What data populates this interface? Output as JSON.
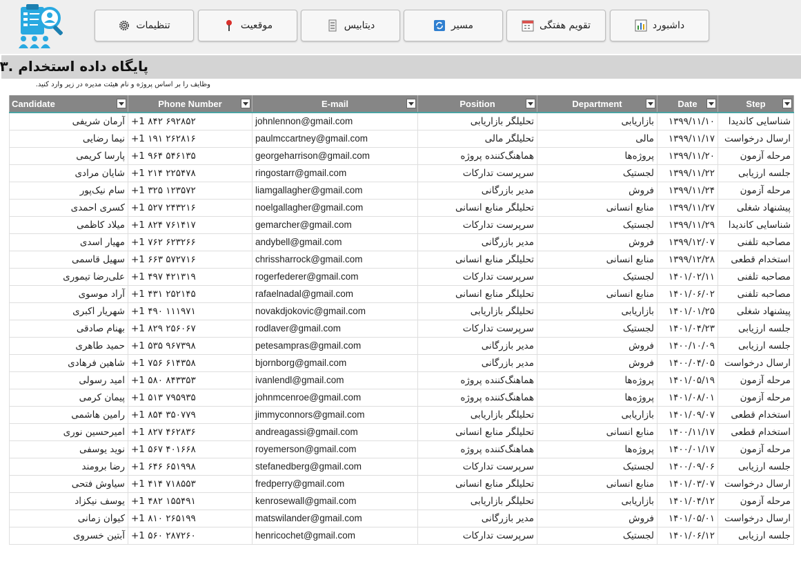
{
  "nav": {
    "buttons": [
      {
        "label": "داشبورد",
        "icon": "bar-chart-icon"
      },
      {
        "label": "تقویم هفتگی",
        "icon": "calendar-icon"
      },
      {
        "label": "مسیر",
        "icon": "refresh-icon"
      },
      {
        "label": "دیتابیس",
        "icon": "database-icon"
      },
      {
        "label": "موقعیت",
        "icon": "pin-icon"
      },
      {
        "label": "تنظیمات",
        "icon": "gear-icon"
      }
    ]
  },
  "page": {
    "title": "پایگاه داده استخدام .۳",
    "subtitle": "وظایف را بر اساس پروژه و نام هیئت مدیره در زیر وارد کنید."
  },
  "colors": {
    "header_bg": "#868686",
    "accent_line": "#4aa3a3",
    "email_link": "#1f5fbf",
    "title_bar": "#d4d4d4"
  },
  "table": {
    "headers": {
      "candidate": "Candidate",
      "phone": "Phone Number",
      "email": "E-mail",
      "position": "Position",
      "department": "Department",
      "date": "Date",
      "step": "Step"
    },
    "rows": [
      {
        "candidate": "آرمان شریفی",
        "phone": "+1 ۸۴۲ ۶۹۲۸۵۲",
        "email": "johnlennon@gmail.com",
        "position": "تحلیلگر بازاریابی",
        "department": "بازاریابی",
        "date": "۱۳۹۹/۱۱/۱۰",
        "step": "شناسایی کاندیدا"
      },
      {
        "candidate": "نیما رضایی",
        "phone": "+1 ۱۹۱ ۲۶۲۸۱۶",
        "email": "paulmccartney@gmail.com",
        "position": "تحلیلگر مالی",
        "department": "مالی",
        "date": "۱۳۹۹/۱۱/۱۷",
        "step": "ارسال درخواست"
      },
      {
        "candidate": "پارسا کریمی",
        "phone": "+1 ۹۶۴ ۵۴۶۱۳۵",
        "email": "georgeharrison@gmail.com",
        "position": "هماهنگ‌کننده پروژه",
        "department": "پروژه‌ها",
        "date": "۱۳۹۹/۱۱/۲۰",
        "step": "مرحله آزمون"
      },
      {
        "candidate": "شایان مرادی",
        "phone": "+1 ۲۱۴ ۲۲۵۴۷۸",
        "email": "ringostarr@gmail.com",
        "position": "سرپرست تدارکات",
        "department": "لجستیک",
        "date": "۱۳۹۹/۱۱/۲۲",
        "step": "جلسه ارزیابی"
      },
      {
        "candidate": "سام نیک‌پور",
        "phone": "+1 ۳۲۵ ۱۲۳۵۷۲",
        "email": "liamgallagher@gmail.com",
        "position": "مدیر بازرگانی",
        "department": "فروش",
        "date": "۱۳۹۹/۱۱/۲۴",
        "step": "مرحله آزمون"
      },
      {
        "candidate": "کسری احمدی",
        "phone": "+1 ۵۲۷ ۲۴۳۲۱۶",
        "email": "noelgallagher@gmail.com",
        "position": "تحلیلگر منابع انسانی",
        "department": "منابع انسانی",
        "date": "۱۳۹۹/۱۱/۲۷",
        "step": "پیشنهاد شغلی"
      },
      {
        "candidate": "میلاد کاظمی",
        "phone": "+1 ۸۲۴ ۷۶۱۴۱۷",
        "email": "gemarcher@gmail.com",
        "position": "سرپرست تدارکات",
        "department": "لجستیک",
        "date": "۱۳۹۹/۱۱/۲۹",
        "step": "شناسایی کاندیدا"
      },
      {
        "candidate": "مهیار اسدی",
        "phone": "+1 ۷۶۲ ۶۲۳۲۶۶",
        "email": "andybell@gmail.com",
        "position": "مدیر بازرگانی",
        "department": "فروش",
        "date": "۱۳۹۹/۱۲/۰۷",
        "step": "مصاحبه تلفنی"
      },
      {
        "candidate": "سهیل قاسمی",
        "phone": "+1 ۶۶۳ ۵۷۲۷۱۶",
        "email": "chrissharrock@gmail.com",
        "position": "تحلیلگر منابع انسانی",
        "department": "منابع انسانی",
        "date": "۱۳۹۹/۱۲/۲۸",
        "step": "استخدام قطعی"
      },
      {
        "candidate": "علی‌رضا تیموری",
        "phone": "+1 ۴۹۷ ۴۲۱۳۱۹",
        "email": "rogerfederer@gmail.com",
        "position": "سرپرست تدارکات",
        "department": "لجستیک",
        "date": "۱۴۰۱/۰۲/۱۱",
        "step": "مصاحبه تلفنی"
      },
      {
        "candidate": "آراد موسوی",
        "phone": "+1 ۴۳۱ ۲۵۲۱۴۵",
        "email": "rafaelnadal@gmail.com",
        "position": "تحلیلگر منابع انسانی",
        "department": "منابع انسانی",
        "date": "۱۴۰۱/۰۶/۰۲",
        "step": "مصاحبه تلفنی"
      },
      {
        "candidate": "شهریار اکبری",
        "phone": "+1 ۴۹۰ ۱۱۱۹۷۱",
        "email": "novakdjokovic@gmail.com",
        "position": "تحلیلگر بازاریابی",
        "department": "بازاریابی",
        "date": "۱۴۰۱/۰۱/۲۵",
        "step": "پیشنهاد شغلی"
      },
      {
        "candidate": "بهنام صادقی",
        "phone": "+1 ۸۲۹ ۲۵۶۰۶۷",
        "email": "rodlaver@gmail.com",
        "position": "سرپرست تدارکات",
        "department": "لجستیک",
        "date": "۱۴۰۱/۰۴/۲۳",
        "step": "جلسه ارزیابی"
      },
      {
        "candidate": "حمید طاهری",
        "phone": "+1 ۵۳۵ ۹۶۷۳۹۸",
        "email": "petesampras@gmail.com",
        "position": "مدیر بازرگانی",
        "department": "فروش",
        "date": "۱۴۰۰/۱۰/۰۹",
        "step": "جلسه ارزیابی"
      },
      {
        "candidate": "شاهین فرهادی",
        "phone": "+1 ۷۵۶ ۶۱۴۳۵۸",
        "email": "bjornborg@gmail.com",
        "position": "مدیر بازرگانی",
        "department": "فروش",
        "date": "۱۴۰۰/۰۴/۰۵",
        "step": "ارسال درخواست"
      },
      {
        "candidate": "امید رسولی",
        "phone": "+1 ۵۸۰ ۸۴۳۳۵۳",
        "email": "ivanlendl@gmail.com",
        "position": "هماهنگ‌کننده پروژه",
        "department": "پروژه‌ها",
        "date": "۱۴۰۱/۰۵/۱۹",
        "step": "مرحله آزمون"
      },
      {
        "candidate": "پیمان کرمی",
        "phone": "+1 ۵۱۳ ۷۹۵۹۳۵",
        "email": "johnmcenroe@gmail.com",
        "position": "هماهنگ‌کننده پروژه",
        "department": "پروژه‌ها",
        "date": "۱۴۰۱/۰۸/۰۱",
        "step": "مرحله آزمون"
      },
      {
        "candidate": "رامین هاشمی",
        "phone": "+1 ۸۵۴ ۳۵۰۷۷۹",
        "email": "jimmyconnors@gmail.com",
        "position": "تحلیلگر بازاریابی",
        "department": "بازاریابی",
        "date": "۱۴۰۱/۰۹/۰۷",
        "step": "استخدام قطعی"
      },
      {
        "candidate": "امیرحسین نوری",
        "phone": "+1 ۸۲۷ ۴۶۲۸۳۶",
        "email": "andreagassi@gmail.com",
        "position": "تحلیلگر منابع انسانی",
        "department": "منابع انسانی",
        "date": "۱۴۰۰/۱۱/۱۷",
        "step": "استخدام قطعی"
      },
      {
        "candidate": "نوید یوسفی",
        "phone": "+1 ۵۶۷ ۴۰۱۶۶۸",
        "email": "royemerson@gmail.com",
        "position": "هماهنگ‌کننده پروژه",
        "department": "پروژه‌ها",
        "date": "۱۴۰۰/۰۱/۱۷",
        "step": "مرحله آزمون"
      },
      {
        "candidate": "رضا برومند",
        "phone": "+1 ۶۴۶ ۶۵۱۹۹۸",
        "email": "stefanedberg@gmail.com",
        "position": "سرپرست تدارکات",
        "department": "لجستیک",
        "date": "۱۴۰۰/۰۹/۰۶",
        "step": "جلسه ارزیابی"
      },
      {
        "candidate": "سیاوش فتحی",
        "phone": "+1 ۴۱۴ ۷۱۸۵۵۳",
        "email": "fredperry@gmail.com",
        "position": "تحلیلگر منابع انسانی",
        "department": "منابع انسانی",
        "date": "۱۴۰۱/۰۳/۰۷",
        "step": "ارسال درخواست"
      },
      {
        "candidate": "یوسف نیکزاد",
        "phone": "+1 ۴۸۲ ۱۵۵۴۹۱",
        "email": "kenrosewall@gmail.com",
        "position": "تحلیلگر بازاریابی",
        "department": "بازاریابی",
        "date": "۱۴۰۱/۰۴/۱۲",
        "step": "مرحله آزمون"
      },
      {
        "candidate": "کیوان زمانی",
        "phone": "+1 ۸۱۰ ۲۶۵۱۹۹",
        "email": "matswilander@gmail.com",
        "position": "مدیر بازرگانی",
        "department": "فروش",
        "date": "۱۴۰۱/۰۵/۰۱",
        "step": "ارسال درخواست"
      },
      {
        "candidate": "آبتین خسروی",
        "phone": "+1 ۵۶۰ ۲۸۷۲۶۰",
        "email": "henricochet@gmail.com",
        "position": "سرپرست تدارکات",
        "department": "لجستیک",
        "date": "۱۴۰۱/۰۶/۱۲",
        "step": "جلسه ارزیابی"
      }
    ]
  }
}
